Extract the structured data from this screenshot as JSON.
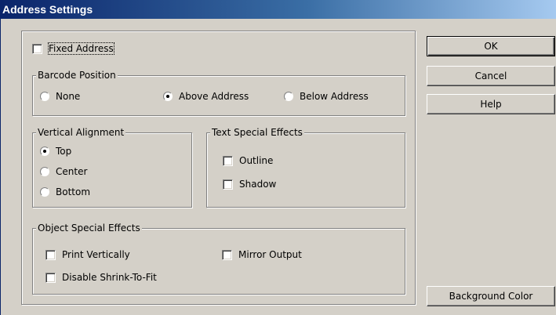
{
  "window": {
    "title": "Address Settings"
  },
  "fixed_address": {
    "label": "Fixed Address",
    "checked": false
  },
  "barcode_position": {
    "legend": "Barcode Position",
    "options": [
      {
        "label": "None",
        "selected": false
      },
      {
        "label": "Above Address",
        "selected": true
      },
      {
        "label": "Below Address",
        "selected": false
      }
    ]
  },
  "vertical_alignment": {
    "legend": "Vertical Alignment",
    "options": [
      {
        "label": "Top",
        "selected": true
      },
      {
        "label": "Center",
        "selected": false
      },
      {
        "label": "Bottom",
        "selected": false
      }
    ]
  },
  "text_special_effects": {
    "legend": "Text Special Effects",
    "options": [
      {
        "label": "Outline",
        "checked": false
      },
      {
        "label": "Shadow",
        "checked": false
      }
    ]
  },
  "object_special_effects": {
    "legend": "Object Special Effects",
    "options": [
      {
        "label": "Print Vertically",
        "checked": false
      },
      {
        "label": "Mirror Output",
        "checked": false
      },
      {
        "label": "Disable Shrink-To-Fit",
        "checked": false
      }
    ]
  },
  "buttons": {
    "ok": "OK",
    "cancel": "Cancel",
    "help": "Help",
    "background_color": "Background Color"
  }
}
